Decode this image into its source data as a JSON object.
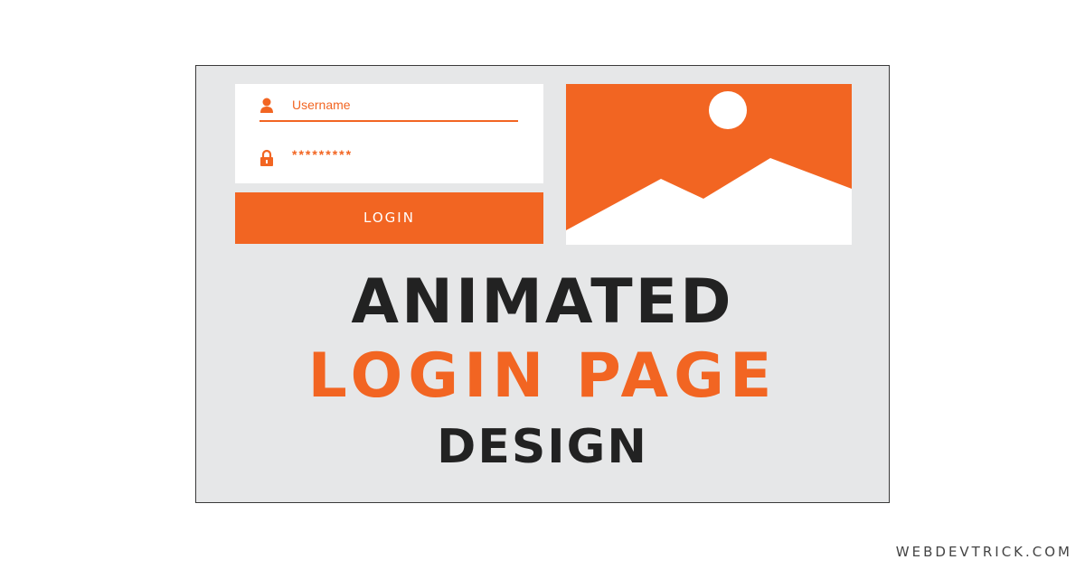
{
  "login_form": {
    "username_value": "Username",
    "password_value": "*********",
    "login_button_label": "LOGIN"
  },
  "headline": {
    "line1": "ANIMATED",
    "line2": "LOGIN PAGE",
    "line3": "DESIGN"
  },
  "watermark": "WEBDEVTRICK.COM",
  "icons": {
    "username": "user-icon",
    "password": "lock-icon",
    "image": "image-placeholder-icon"
  },
  "colors": {
    "accent": "#f26522",
    "background": "#e6e7e8",
    "text_dark": "#222222",
    "card": "#ffffff"
  }
}
